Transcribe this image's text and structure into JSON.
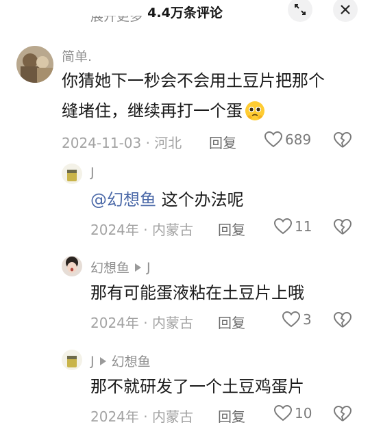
{
  "header": {
    "title": "4.4万条评论",
    "cut_text": "展开更多"
  },
  "colors": {
    "mention": "#4b69a8",
    "meta": "#a3a3a3"
  },
  "comments": [
    {
      "user": "简单.",
      "text_line1": "你猜她下一秒会不会用土豆片把那个",
      "text_line2": "缝堵住，继续再打一个蛋",
      "emoji": "pleading-face-icon",
      "date": "2024-11-03 · 河北",
      "reply": "回复",
      "likes": "689"
    },
    {
      "user": "J",
      "mention": "@幻想鱼",
      "text": " 这个办法呢",
      "date": "2024年 · 内蒙古",
      "reply": "回复",
      "likes": "11"
    },
    {
      "user": "幻想鱼",
      "reply_to": "J",
      "text": "那有可能蛋液粘在土豆片上哦",
      "date": "2024年 · 内蒙古",
      "reply": "回复",
      "likes": "3"
    },
    {
      "user": "J",
      "reply_to": "幻想鱼",
      "text": "那不就研发了一个土豆鸡蛋片",
      "date": "2024年 · 内蒙古",
      "reply": "回复",
      "likes": "10"
    }
  ]
}
